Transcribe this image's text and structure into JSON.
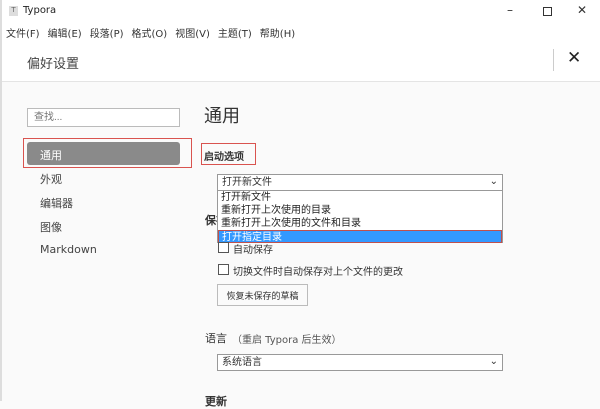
{
  "window": {
    "title": "Typora"
  },
  "menu": [
    "文件(F)",
    "编辑(E)",
    "段落(P)",
    "格式(O)",
    "视图(V)",
    "主题(T)",
    "帮助(H)"
  ],
  "header": {
    "title": "偏好设置"
  },
  "sidebar": {
    "search_placeholder": "查找...",
    "items": [
      "通用",
      "外观",
      "编辑器",
      "图像",
      "Markdown"
    ],
    "selected": "通用"
  },
  "main": {
    "title": "通用",
    "startup": {
      "label": "启动选项",
      "value": "打开新文件",
      "options": [
        "打开新文件",
        "重新打开上次使用的目录",
        "重新打开上次使用的文件和目录",
        "打开指定目录"
      ],
      "highlighted": "打开指定目录"
    },
    "save": {
      "label": "保存",
      "auto_save": "自动保存",
      "auto_save_switch": "切换文件时自动保存对上个文件的更改",
      "recover_button": "恢复未保存的草稿"
    },
    "language": {
      "label": "语言",
      "note": "（重启 Typora 后生效）",
      "value": "系统语言"
    },
    "update": {
      "label": "更新"
    }
  },
  "colors": {
    "highlight": "#3399ff",
    "annotation": "#d9534f",
    "selected_bg": "#8a8a8a"
  }
}
